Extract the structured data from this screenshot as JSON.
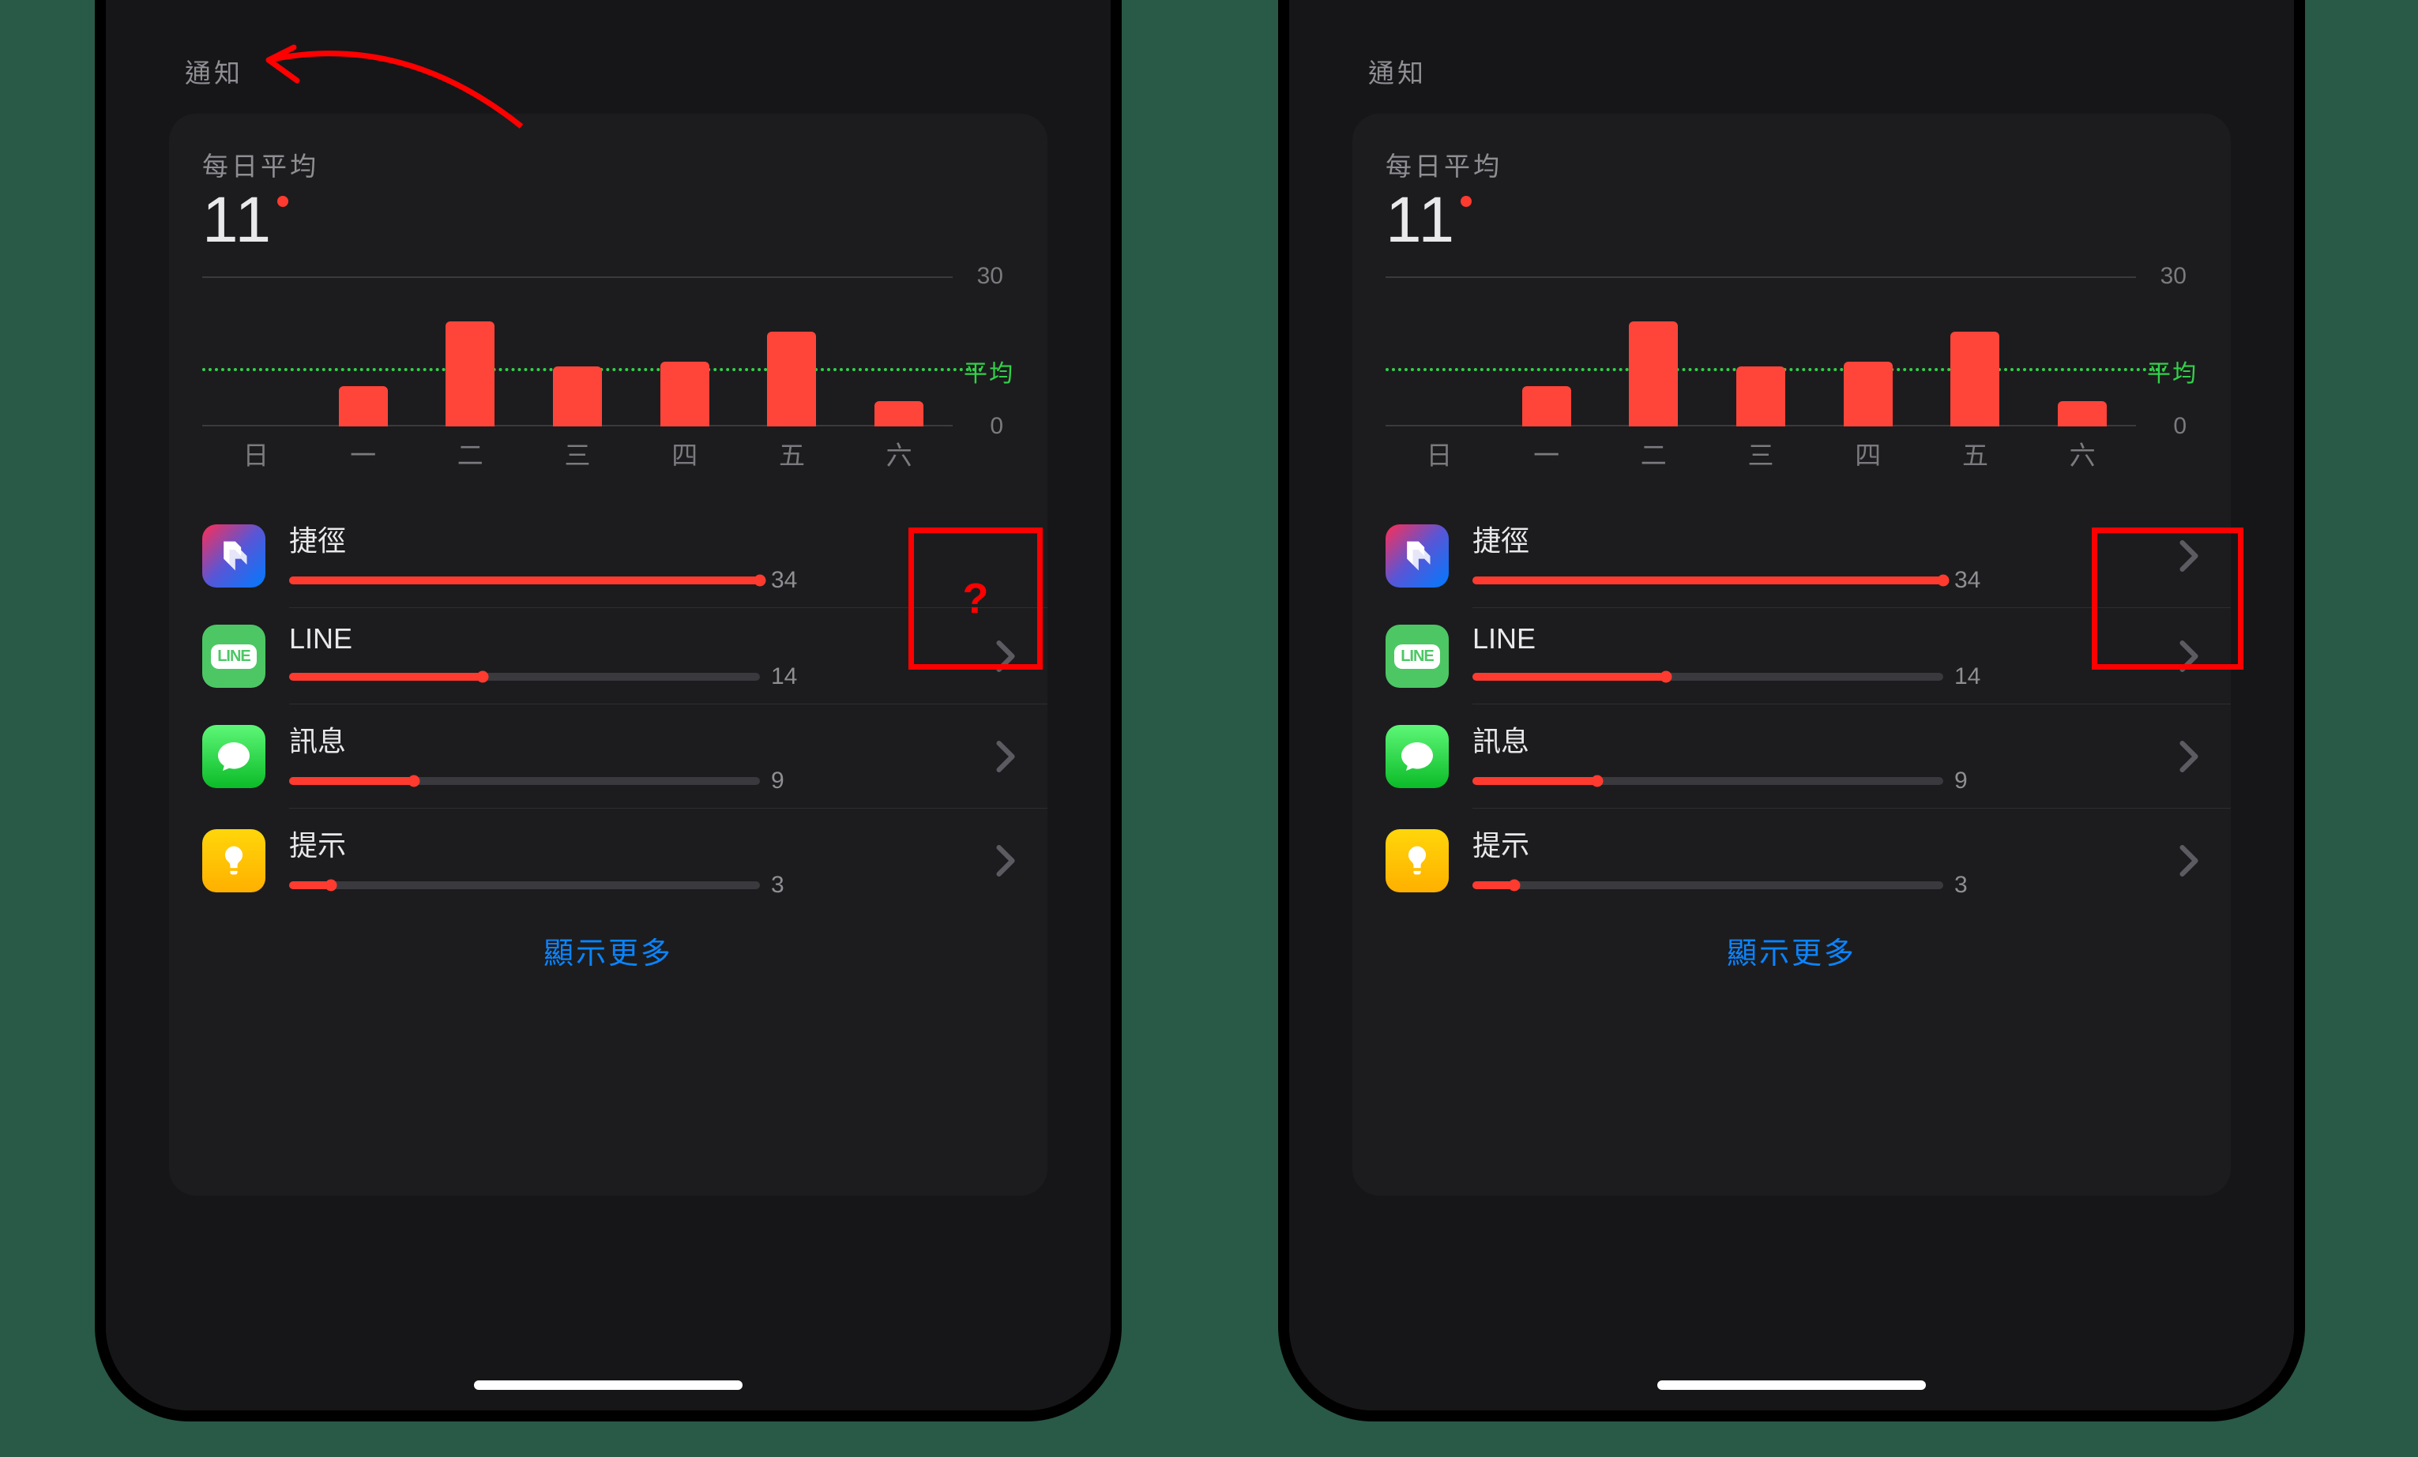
{
  "nav_title": "通知",
  "daily": {
    "label": "每日平均",
    "value": "11"
  },
  "chart_data": {
    "type": "bar",
    "categories": [
      "日",
      "一",
      "二",
      "三",
      "四",
      "五",
      "六"
    ],
    "values": [
      0,
      8,
      21,
      12,
      13,
      19,
      5
    ],
    "average_line_label": "平均",
    "average_value": 11,
    "ylim": [
      0,
      30
    ],
    "yticks": [
      0,
      30
    ],
    "bar_color": "#FF453A",
    "average_color": "#32D14A"
  },
  "apps": {
    "max": 34,
    "items": [
      {
        "name": "捷徑",
        "count": 34,
        "icon": "shortcuts"
      },
      {
        "name": "LINE",
        "count": 14,
        "icon": "line"
      },
      {
        "name": "訊息",
        "count": 9,
        "icon": "messages"
      },
      {
        "name": "提示",
        "count": 3,
        "icon": "tips"
      }
    ]
  },
  "show_more_label": "顯示更多",
  "annotations": {
    "left_overlay": "?",
    "left_has_arrow": true
  }
}
